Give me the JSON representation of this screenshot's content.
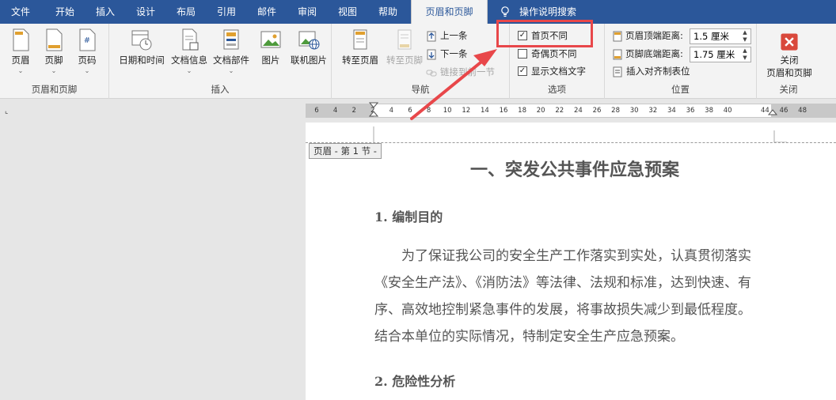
{
  "tabs": [
    "文件",
    "开始",
    "插入",
    "设计",
    "布局",
    "引用",
    "邮件",
    "审阅",
    "视图",
    "帮助",
    "页眉和页脚"
  ],
  "tell_me": "操作说明搜索",
  "ribbon": {
    "groups": {
      "header_footer": "页眉和页脚",
      "insert": "插入",
      "navigation": "导航",
      "options": "选项",
      "position": "位置",
      "close": "关闭"
    },
    "header_btn": "页眉",
    "footer_btn": "页脚",
    "page_number_btn": "页码",
    "date_time_btn": "日期和时间",
    "doc_info_btn": "文档信息",
    "doc_parts_btn": "文档部件",
    "picture_btn": "图片",
    "online_picture_btn": "联机图片",
    "goto_header_btn": "转至页眉",
    "goto_footer_btn": "转至页脚",
    "prev_btn": "上一条",
    "next_btn": "下一条",
    "link_prev_btn": "链接到前一节",
    "diff_first_page": "首页不同",
    "diff_odd_even": "奇偶页不同",
    "show_doc_text": "显示文档文字",
    "header_from_top_label": "页眉顶端距离:",
    "header_from_top_value": "1.5 厘米",
    "footer_from_bottom_label": "页脚底端距离:",
    "footer_from_bottom_value": "1.75 厘米",
    "insert_align_tab": "插入对齐制表位",
    "close_btn_line1": "关闭",
    "close_btn_line2": "页眉和页脚"
  },
  "checkboxes": {
    "diff_first_page": true,
    "diff_odd_even": false,
    "show_doc_text": true
  },
  "ruler_ticks": [
    "6",
    "4",
    "2",
    "2",
    "4",
    "6",
    "8",
    "10",
    "12",
    "14",
    "16",
    "18",
    "20",
    "22",
    "24",
    "26",
    "28",
    "30",
    "32",
    "34",
    "36",
    "38",
    "40",
    "44",
    "46",
    "48"
  ],
  "document": {
    "header_tag": "页眉 - 第 1 节 -",
    "title": "一、突发公共事件应急预案",
    "section1": "1. 编制目的",
    "para_lines": [
      "为了保证我公司的安全生产工作落实到实处，认真贯彻落实",
      "《安全生产法》、《消防法》等法律、法规和标准，达到快速、有",
      "序、高效地控制紧急事件的发展，将事故损失减少到最低程度。",
      "结合本单位的实际情况，特制定安全生产应急预案。"
    ],
    "section2": "2. 危险性分析"
  },
  "colors": {
    "tabbar": "#2b579a",
    "highlight": "#e8474a",
    "close_icon": "#d9483b"
  }
}
